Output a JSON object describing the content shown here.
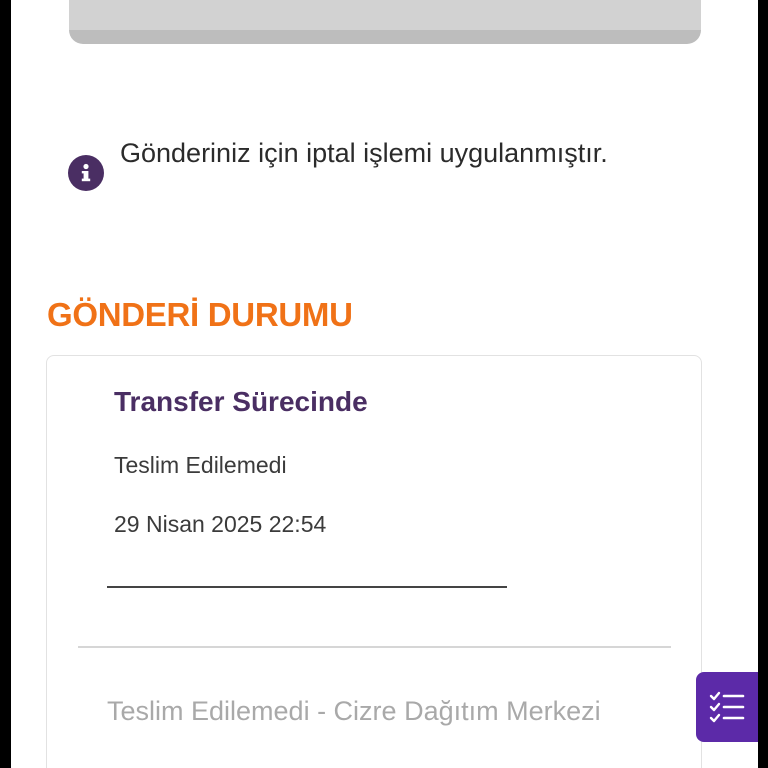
{
  "notice": {
    "text": "Gönderiniz için iptal işlemi uygulanmıştır.",
    "icon": "info-icon"
  },
  "status_section": {
    "title": "GÖNDERİ DURUMU",
    "current": {
      "title": "Transfer Sürecinde",
      "subtitle": "Teslim Edilemedi",
      "datetime": "29 Nisan 2025 22:54"
    },
    "history": [
      {
        "text": "Teslim Edilemedi - Cizre Dağıtım Merkezi"
      }
    ]
  },
  "fab": {
    "icon": "checklist-icon"
  },
  "colors": {
    "accent_orange": "#f07217",
    "brand_purple": "#4a2e63",
    "fab_purple": "#5c2aa8",
    "muted_text": "#a9a9a9"
  }
}
